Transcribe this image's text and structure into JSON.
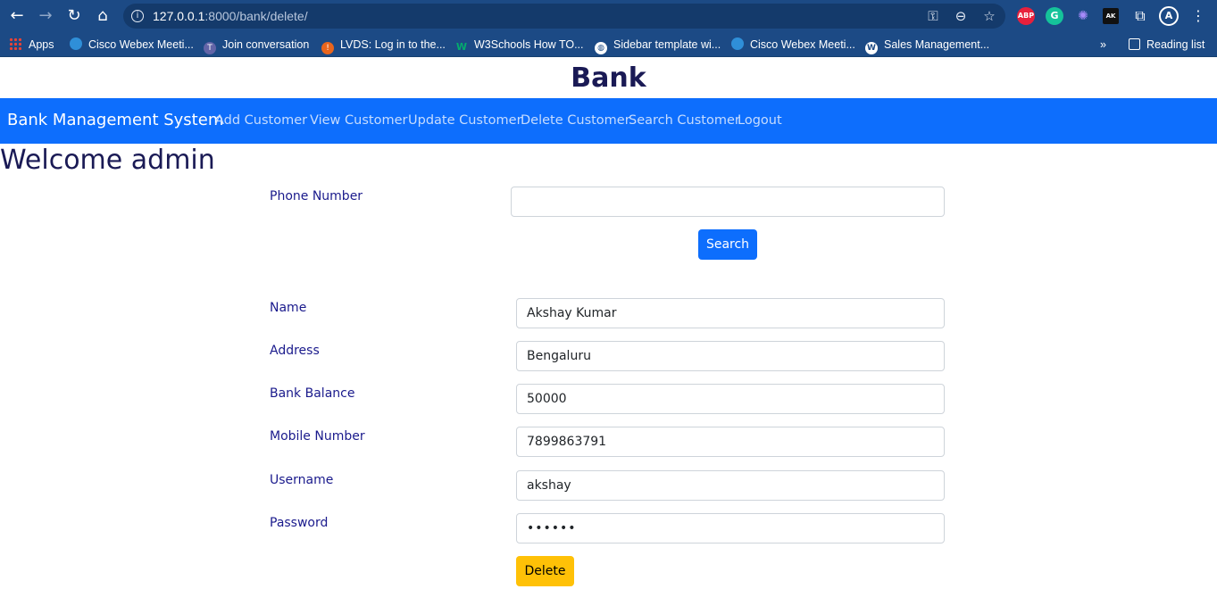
{
  "browser": {
    "url_host": "127.0.0.1",
    "url_path": ":8000/bank/delete/",
    "bookmarks": [
      {
        "label": "Apps",
        "icon": "apps-grid-icon"
      },
      {
        "label": "Cisco Webex Meeti...",
        "icon": "webex-icon"
      },
      {
        "label": "Join conversation",
        "icon": "teams-icon"
      },
      {
        "label": "LVDS: Log in to the...",
        "icon": "lvds-icon"
      },
      {
        "label": "W3Schools How TO...",
        "icon": "w3schools-icon"
      },
      {
        "label": "Sidebar template wi...",
        "icon": "globe-icon"
      },
      {
        "label": "Cisco Webex Meeti...",
        "icon": "webex-icon"
      },
      {
        "label": "Sales Management...",
        "icon": "wordpress-icon"
      }
    ],
    "overflow": "»",
    "reading_list": "Reading list",
    "extensions": [
      {
        "label": "ABP",
        "color": "#e8203c"
      },
      {
        "label": "G",
        "color": "#15c39a"
      },
      {
        "label": "✺",
        "color": "#5b3bd8"
      },
      {
        "label": "AK",
        "color": "#111111"
      }
    ]
  },
  "page": {
    "title": "Bank",
    "navbar": {
      "brand": "Bank Management System",
      "links": [
        "Add Customer",
        "View Customer",
        "Update Customer",
        "Delete Customer",
        "Search Customer",
        "Logout"
      ]
    },
    "welcome": "Welcome admin",
    "search": {
      "label": "Phone Number",
      "value": "",
      "button": "Search"
    },
    "form": {
      "name_label": "Name",
      "name_value": "Akshay Kumar",
      "address_label": "Address",
      "address_value": "Bengaluru",
      "balance_label": "Bank Balance",
      "balance_value": "50000",
      "mobile_label": "Mobile Number",
      "mobile_value": "7899863791",
      "username_label": "Username",
      "username_value": "akshay",
      "password_label": "Password",
      "password_value": "••••••",
      "delete_button": "Delete"
    }
  },
  "colors": {
    "navbar": "#0d6efd",
    "browser_chrome": "#1c4a85",
    "label": "#1a1a8c",
    "delete_button": "#ffc107"
  }
}
